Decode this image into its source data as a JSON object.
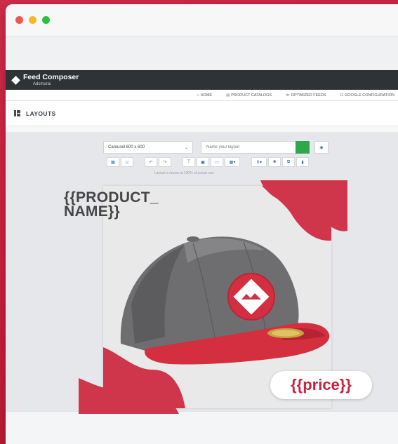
{
  "window": {
    "traffic_lights": [
      "close-dot",
      "minimize-dot",
      "maximize-dot"
    ]
  },
  "app": {
    "brand_name": "Feed Composer",
    "brand_sub": "Adsmurai"
  },
  "nav": {
    "items": [
      {
        "icon": "home-icon",
        "glyph": "⌂",
        "label": "HOME"
      },
      {
        "icon": "cart-icon",
        "glyph": "▤",
        "label": "PRODUCT CATALOGS"
      },
      {
        "icon": "feed-icon",
        "glyph": "≫",
        "label": "OPTIMIZED FEEDS"
      },
      {
        "icon": "google-icon",
        "glyph": "G",
        "label": "GOOGLE CONFIGURATION"
      }
    ]
  },
  "page": {
    "title": "LAYOUTS"
  },
  "toolbar": {
    "size_select_value": "Carousel 600 x 600",
    "layout_name_placeholder": "Name your layout",
    "hint": "Layout is drawn at 100% of actual size"
  },
  "canvas": {
    "product_name_line1": "{{PRODUCT_",
    "product_name_line2": "NAME}}",
    "price": "{{price}}"
  },
  "colors": {
    "accent_red": "#c7233f",
    "save_green": "#2fa74a",
    "appbar_dark": "#2e3338"
  }
}
